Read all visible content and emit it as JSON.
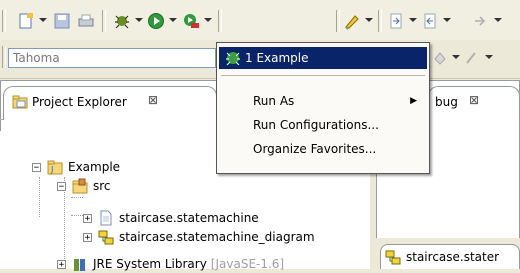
{
  "toolbar": {
    "font_field": "Tahoma",
    "icons": [
      "new-icon",
      "save-icon",
      "print-icon",
      "debug-icon",
      "run-icon",
      "external-tools-icon",
      "marker-icon",
      "next-annotation-icon",
      "prev-annotation-icon"
    ]
  },
  "run_menu": {
    "items": [
      {
        "label": "1 Example",
        "selected": true
      },
      {
        "label": "Run As",
        "has_submenu": true
      },
      {
        "label": "Run Configurations..."
      },
      {
        "label": "Organize Favorites..."
      }
    ]
  },
  "project_explorer": {
    "tab_label": "Project Explorer",
    "tree": [
      {
        "label": "Example",
        "expander": "−"
      },
      {
        "label": "src",
        "expander": "−"
      },
      {
        "label": "staircase.statemachine",
        "expander": "+"
      },
      {
        "label": "staircase.statemachine_diagram",
        "expander": "+"
      },
      {
        "label": "JRE System Library",
        "suffix": "[JavaSE-1.6]",
        "expander": "+"
      }
    ]
  },
  "debug_view": {
    "tab_label": "bug"
  },
  "editor": {
    "tab_label": "staircase.stater"
  },
  "colors": {
    "selection": "#0a246a",
    "background": "#ece9d8"
  }
}
